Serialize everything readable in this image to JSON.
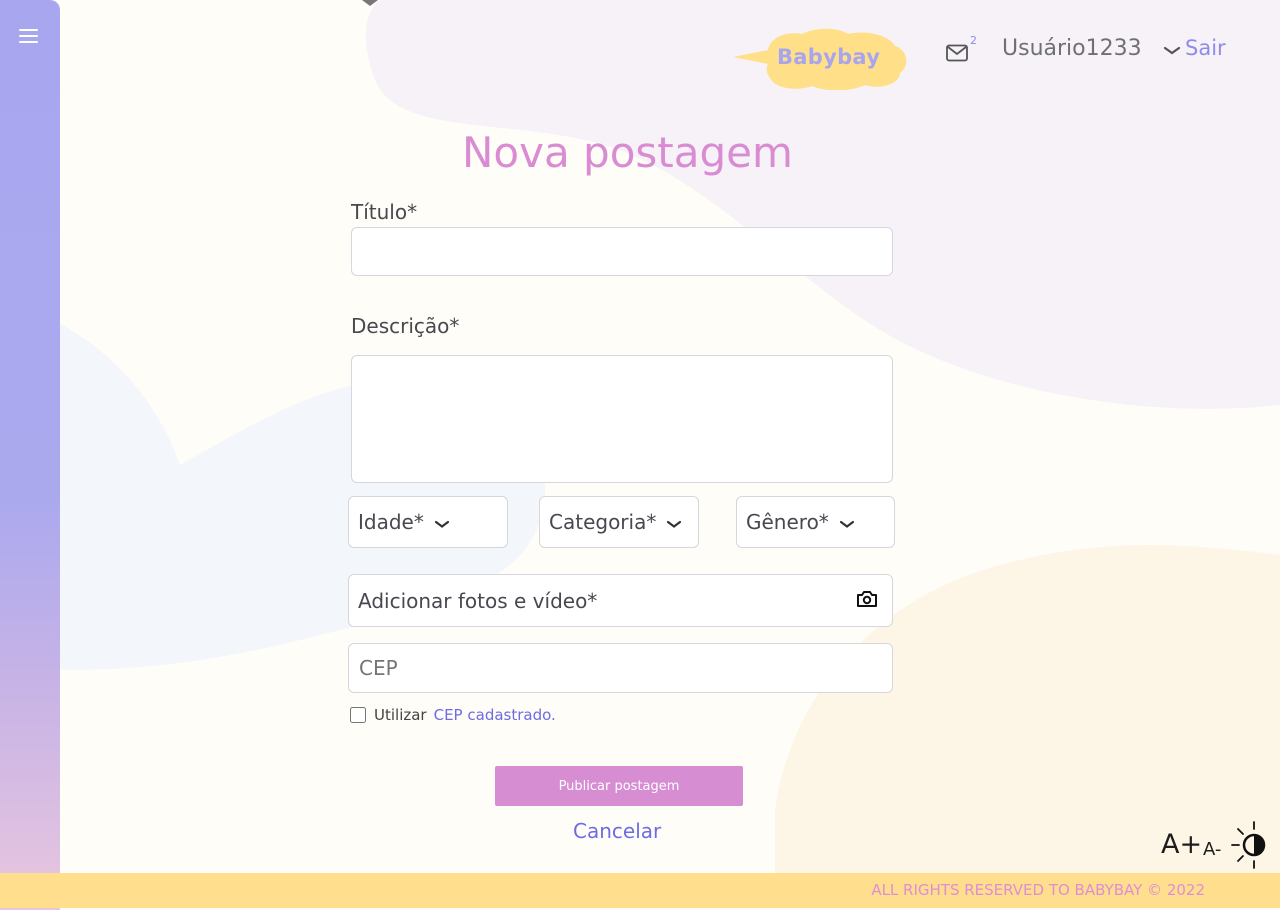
{
  "header": {
    "logo_text": "Babybay",
    "mail_badge": "2",
    "username": "Usuário1233",
    "logout_label": "Sair"
  },
  "form": {
    "title": "Nova postagem",
    "title_label": "Título*",
    "description_label": "Descrição*",
    "age_label": "Idade*",
    "category_label": "Categoria*",
    "gender_label": "Gênero*",
    "upload_label": "Adicionar fotos e vídeo*",
    "cep_placeholder": "CEP",
    "use_cep_text": "Utilizar",
    "use_cep_link": "CEP cadastrado.",
    "publish_label": "Publicar postagem",
    "cancel_label": "Cancelar"
  },
  "accessibility": {
    "font_increase": "A+",
    "font_decrease": "A-"
  },
  "footer": {
    "text": "ALL RIGHTS RESERVED TO BABYBAY © 2022"
  },
  "colors": {
    "sidebar": "#a8a6ef",
    "title": "#d98cd2",
    "link": "#6d6ce4",
    "publish_button": "#d78dd2",
    "footer": "#ffde8e",
    "logo_cloud": "#ffe089"
  }
}
